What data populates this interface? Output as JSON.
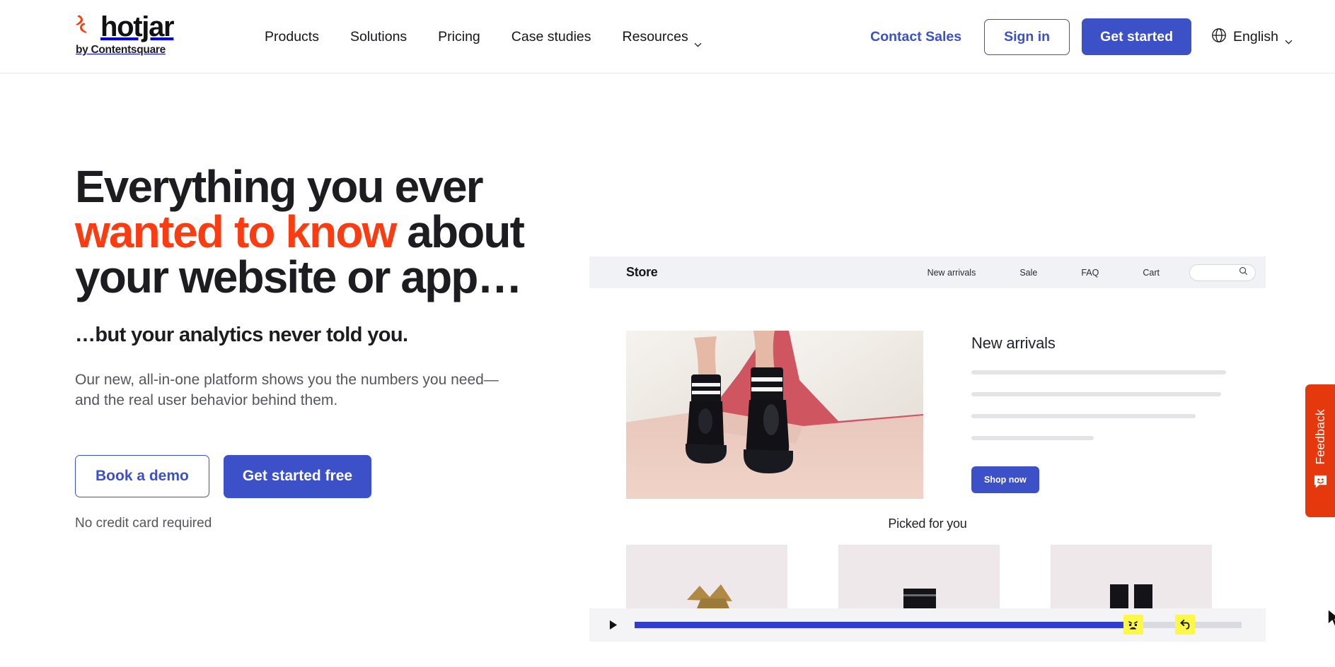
{
  "header": {
    "brand": {
      "name": "hotjar",
      "tagline": "by Contentsquare",
      "mark_icon": "hotjar-flame-icon"
    },
    "nav": [
      {
        "label": "Products",
        "has_caret": false
      },
      {
        "label": "Solutions",
        "has_caret": false
      },
      {
        "label": "Pricing",
        "has_caret": false
      },
      {
        "label": "Case studies",
        "has_caret": false
      },
      {
        "label": "Resources",
        "has_caret": true
      }
    ],
    "contact_sales": "Contact Sales",
    "sign_in": "Sign in",
    "get_started": "Get started",
    "language": {
      "label": "English",
      "icon": "globe-icon",
      "caret_icon": "chevron-down-icon"
    }
  },
  "hero": {
    "headline_part1": "Everything you ever ",
    "headline_highlight": "wanted to know",
    "headline_part2": " about your website or app…",
    "subhead": "…but your analytics never told you.",
    "lede": "Our new, all-in-one platform shows you the numbers you need—and the real user behavior behind them.",
    "cta_primary": "Get started free",
    "cta_secondary": "Book a demo",
    "note": "No credit card required"
  },
  "mock_store": {
    "title": "Store",
    "nav": [
      "New arrivals",
      "Sale",
      "FAQ",
      "Cart"
    ],
    "search_icon": "search-icon",
    "section_heading": "New arrivals",
    "skeleton_widths": [
      "100%",
      "98%",
      "88%",
      "48%"
    ],
    "shop_now": "Shop now",
    "picked_title": "Picked for you",
    "cursor_icon": "mouse-cursor-icon"
  },
  "playback": {
    "play_icon": "play-icon",
    "progress_percent": 83,
    "markers": [
      {
        "position_percent": 83,
        "icon": "rage-click-icon",
        "glyph": "angry-face"
      },
      {
        "position_percent": 91,
        "icon": "u-turn-icon",
        "glyph": "return-arrow"
      }
    ]
  },
  "feedback_tab": {
    "label": "Feedback",
    "icon": "smiley-speech-bubble-icon"
  },
  "colors": {
    "brand_blue": "#3c50c8",
    "accent_orange": "#f93c12",
    "feedback_red": "#e5380d",
    "marker_yellow": "#fbf84a",
    "progress_blue": "#2f3fcb",
    "text_dark": "#1c1c21",
    "text_muted": "#55555f"
  }
}
